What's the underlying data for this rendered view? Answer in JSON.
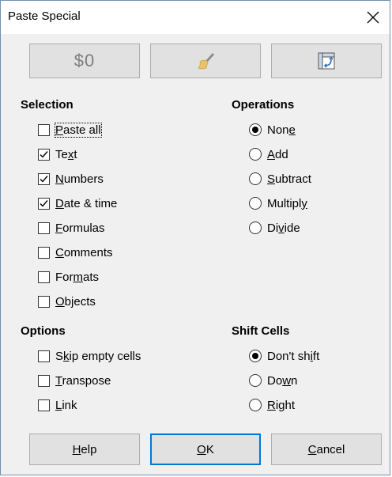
{
  "window": {
    "title": "Paste Special"
  },
  "presets": {
    "values_only_label": "$0",
    "values_only_icon": "values-only",
    "formats_only_icon": "paintbrush",
    "transpose_all_icon": "transpose"
  },
  "selection": {
    "title": "Selection",
    "items": [
      {
        "pre": "",
        "key": "P",
        "post": "aste all",
        "checked": false
      },
      {
        "pre": "Te",
        "key": "x",
        "post": "t",
        "checked": true
      },
      {
        "pre": "",
        "key": "N",
        "post": "umbers",
        "checked": true
      },
      {
        "pre": "",
        "key": "D",
        "post": "ate & time",
        "checked": true
      },
      {
        "pre": "",
        "key": "F",
        "post": "ormulas",
        "checked": false
      },
      {
        "pre": "",
        "key": "C",
        "post": "omments",
        "checked": false
      },
      {
        "pre": "For",
        "key": "m",
        "post": "ats",
        "checked": false
      },
      {
        "pre": "",
        "key": "O",
        "post": "bjects",
        "checked": false
      }
    ]
  },
  "operations": {
    "title": "Operations",
    "items": [
      {
        "pre": "Non",
        "key": "e",
        "post": "",
        "selected": true
      },
      {
        "pre": "",
        "key": "A",
        "post": "dd",
        "selected": false
      },
      {
        "pre": "",
        "key": "S",
        "post": "ubtract",
        "selected": false
      },
      {
        "pre": "Multipl",
        "key": "y",
        "post": "",
        "selected": false
      },
      {
        "pre": "Di",
        "key": "v",
        "post": "ide",
        "selected": false
      }
    ]
  },
  "options": {
    "title": "Options",
    "items": [
      {
        "pre": "S",
        "key": "k",
        "post": "ip empty cells",
        "checked": false
      },
      {
        "pre": "",
        "key": "T",
        "post": "ranspose",
        "checked": false
      },
      {
        "pre": "",
        "key": "L",
        "post": "ink",
        "checked": false
      }
    ]
  },
  "shift_cells": {
    "title": "Shift Cells",
    "items": [
      {
        "pre": "Don't sh",
        "key": "i",
        "post": "ft",
        "selected": true
      },
      {
        "pre": "Do",
        "key": "w",
        "post": "n",
        "selected": false
      },
      {
        "pre": "",
        "key": "R",
        "post": "ight",
        "selected": false
      }
    ]
  },
  "buttons": {
    "help": {
      "pre": "",
      "key": "H",
      "post": "elp"
    },
    "ok": {
      "pre": "",
      "key": "O",
      "post": "K"
    },
    "cancel": {
      "pre": "",
      "key": "C",
      "post": "ancel"
    }
  }
}
